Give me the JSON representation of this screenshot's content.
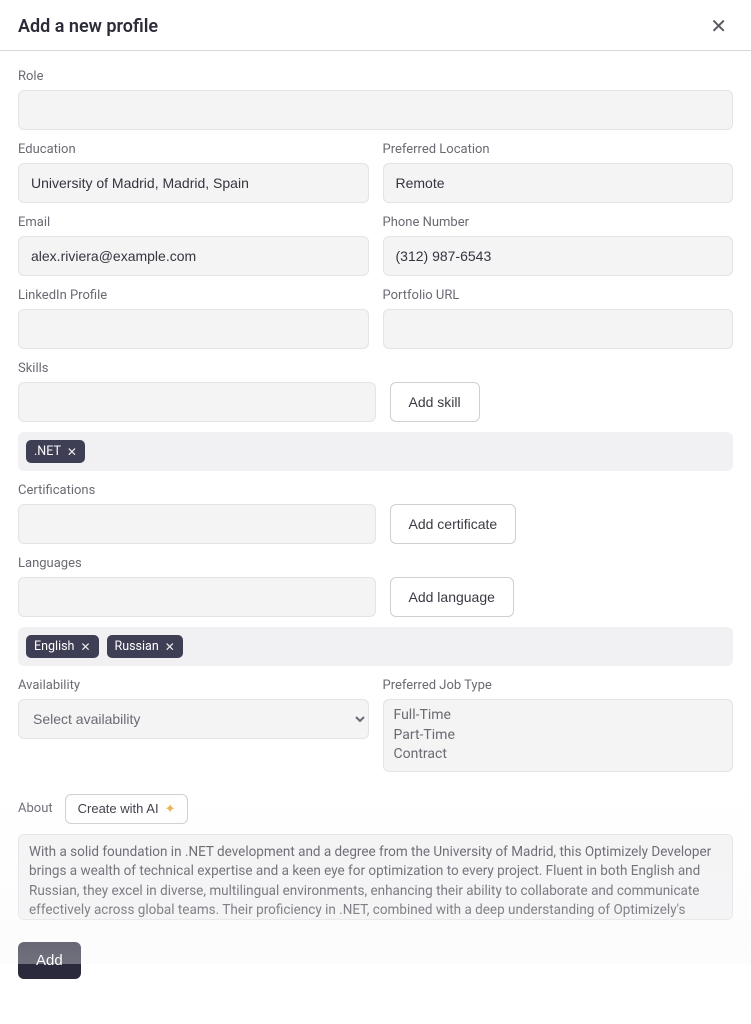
{
  "header": {
    "title": "Add a new profile"
  },
  "labels": {
    "role": "Role",
    "education": "Education",
    "preferred_location": "Preferred Location",
    "email": "Email",
    "phone": "Phone Number",
    "linkedin": "LinkedIn Profile",
    "portfolio": "Portfolio URL",
    "skills": "Skills",
    "certifications": "Certifications",
    "languages": "Languages",
    "availability": "Availability",
    "preferred_job_type": "Preferred Job Type",
    "about": "About"
  },
  "values": {
    "role": "",
    "education": "University of Madrid, Madrid, Spain",
    "preferred_location": "Remote",
    "email": "alex.riviera@example.com",
    "phone": "(312) 987-6543",
    "linkedin": "",
    "portfolio": "",
    "skills_input": "",
    "certifications_input": "",
    "languages_input": "",
    "about": "With a solid foundation in .NET development and a degree from the University of Madrid, this Optimizely Developer brings a wealth of technical expertise and a keen eye for optimization to every project. Fluent in both English and Russian, they excel in diverse, multilingual environments, enhancing their ability to collaborate and communicate effectively across global teams. Their proficiency in .NET, combined with a deep understanding of Optimizely's platform, ensures the delivery of high-quality, scalable solutions tailored to meet specific business needs. This developer is ready to leverage their skills and experience to drive"
  },
  "buttons": {
    "add_skill": "Add skill",
    "add_certificate": "Add certificate",
    "add_language": "Add language",
    "create_with_ai": "Create with AI",
    "add": "Add"
  },
  "skills_chips": [
    ".NET"
  ],
  "languages_chips": [
    "English",
    "Russian"
  ],
  "availability_placeholder": "Select availability",
  "job_type_options": [
    "Full-Time",
    "Part-Time",
    "Contract"
  ]
}
